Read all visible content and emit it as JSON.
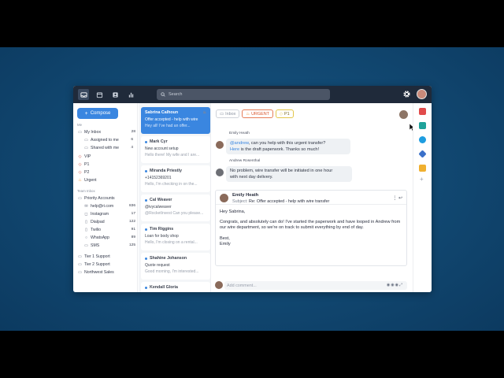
{
  "search": {
    "placeholder": "Search"
  },
  "sidebar": {
    "compose_label": "Compose",
    "section_me": "Me",
    "my_inbox": {
      "label": "My Inbox",
      "count": "28"
    },
    "assigned": {
      "label": "Assigned to me",
      "count": "6"
    },
    "shared": {
      "label": "Shared with me",
      "count": "4"
    },
    "vip": "VIP",
    "p1": "P1",
    "p2": "P2",
    "urgent": "Urgent",
    "section_team": "Team Inbox",
    "priority_accounts": "Priority Accounts",
    "accounts": [
      {
        "label": "help@ri.com",
        "count": "836"
      },
      {
        "label": "Instagram",
        "count": "17"
      },
      {
        "label": "Dialpad",
        "count": "122"
      },
      {
        "label": "Twilio",
        "count": "91"
      },
      {
        "label": "WhatsApp",
        "count": "89"
      },
      {
        "label": "SMS",
        "count": "125"
      }
    ],
    "tier1": "Tier 1 Support",
    "tier2": "Tier 2 Support",
    "northwest": "Northwest Sales"
  },
  "messages": [
    {
      "name": "Sabrina Calhoun",
      "subject": "Offer accepted - help with wire",
      "preview": "Hey all! I've had an offer..."
    },
    {
      "name": "Mark Cyr",
      "subject": "New account setup",
      "preview": "Hello there! My wife and I are..."
    },
    {
      "name": "Miranda Priestly",
      "subject": "+14152369201",
      "preview": "Hello, I'm checking in on the..."
    },
    {
      "name": "Cal Weaver",
      "subject": "@ivycalweaver",
      "preview": "@RocketInvest Can you please..."
    },
    {
      "name": "Tim Riggins",
      "subject": "Loan for body shop",
      "preview": "Hello, I'm closing on a rental..."
    },
    {
      "name": "Shahine Johanson",
      "subject": "Quote request",
      "preview": "Good morning, I'm interested..."
    },
    {
      "name": "Kendall Gloria",
      "subject": "",
      "preview": ""
    }
  ],
  "conversation": {
    "tags": [
      "Inbox",
      "URGENT",
      "P1"
    ],
    "comment1": {
      "author": "Emily Heath",
      "mention": "@andrew",
      "text1": ", can you help with this urgent transfer?",
      "link": "Here",
      "text2": " is the draft paperwork. Thanks so much!"
    },
    "comment2": {
      "author": "Andrew Rosenthal",
      "line1": "No problem, wire transfer will be initiated in one hour",
      "line2": "with next day delivery."
    },
    "email": {
      "from": "Emily Heath",
      "subject_label": "Subject:",
      "subject": "Re: Offer accepted - help with wire transfer",
      "greeting": "Hey Sabrina,",
      "body": "Congrats, and absolutely can do! I've started the paperwork and have looped in Andrew from our wire department, so we're on track to submit everything by end of day.",
      "signoff": "Best,",
      "signature": "Emily"
    },
    "comment_placeholder": "Add comment..."
  },
  "colors": {
    "accent": "#3a86e0",
    "topbar": "#1f2a3a",
    "background": "#124a74"
  }
}
